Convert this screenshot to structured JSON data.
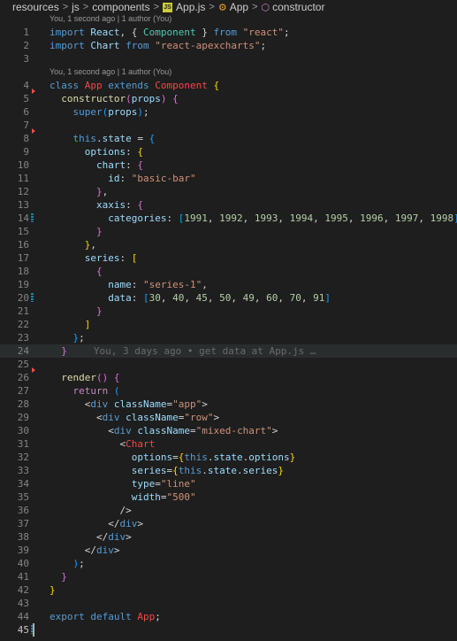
{
  "breadcrumb": {
    "items": [
      "resources",
      "js",
      "components",
      "App.js",
      "App",
      "constructor"
    ],
    "js_badge": "JS"
  },
  "lens": {
    "top": "You, 1 second ago | 1 author (You)",
    "class": "You, 1 second ago | 1 author (You)"
  },
  "blame_line24": "You, 3 days ago • get data at App.js …",
  "lines": [
    {
      "n": "1",
      "tokens": [
        [
          "k",
          "import "
        ],
        [
          "v",
          "React"
        ],
        [
          "p",
          ", { "
        ],
        [
          "c",
          "Component"
        ],
        [
          "p",
          " } "
        ],
        [
          "k",
          "from "
        ],
        [
          "s",
          "\"react\""
        ],
        [
          "p",
          ";"
        ]
      ]
    },
    {
      "n": "2",
      "tokens": [
        [
          "k",
          "import "
        ],
        [
          "v",
          "Chart "
        ],
        [
          "k",
          "from "
        ],
        [
          "s",
          "\"react-apexcharts\""
        ],
        [
          "p",
          ";"
        ]
      ]
    },
    {
      "n": "3",
      "tokens": []
    },
    {
      "n": "4",
      "tokens": [
        [
          "k",
          "class "
        ],
        [
          "err",
          "App"
        ],
        [
          "k",
          " extends "
        ],
        [
          "err",
          "Component"
        ],
        [
          "b1",
          " {"
        ]
      ]
    },
    {
      "n": "5",
      "tokens": [
        [
          "p",
          "  "
        ],
        [
          "f",
          "constructor"
        ],
        [
          "b2",
          "("
        ],
        [
          "v",
          "props"
        ],
        [
          "b2",
          ")"
        ],
        [
          "p",
          " "
        ],
        [
          "b2",
          "{"
        ]
      ]
    },
    {
      "n": "6",
      "tokens": [
        [
          "p",
          "    "
        ],
        [
          "k",
          "super"
        ],
        [
          "b3",
          "("
        ],
        [
          "v",
          "props"
        ],
        [
          "b3",
          ")"
        ],
        [
          "p",
          ";"
        ]
      ]
    },
    {
      "n": "7",
      "tokens": []
    },
    {
      "n": "8",
      "tokens": [
        [
          "p",
          "    "
        ],
        [
          "k",
          "this"
        ],
        [
          "p",
          "."
        ],
        [
          "v",
          "state"
        ],
        [
          "p",
          " = "
        ],
        [
          "b3",
          "{"
        ]
      ]
    },
    {
      "n": "9",
      "tokens": [
        [
          "p",
          "      "
        ],
        [
          "v",
          "options"
        ],
        [
          "p",
          ": "
        ],
        [
          "b1",
          "{"
        ]
      ]
    },
    {
      "n": "10",
      "tokens": [
        [
          "p",
          "        "
        ],
        [
          "v",
          "chart"
        ],
        [
          "p",
          ": "
        ],
        [
          "b2",
          "{"
        ]
      ]
    },
    {
      "n": "11",
      "tokens": [
        [
          "p",
          "          "
        ],
        [
          "v",
          "id"
        ],
        [
          "p",
          ": "
        ],
        [
          "s",
          "\"basic-bar\""
        ]
      ]
    },
    {
      "n": "12",
      "tokens": [
        [
          "p",
          "        "
        ],
        [
          "b2",
          "}"
        ],
        [
          "p",
          ","
        ]
      ]
    },
    {
      "n": "13",
      "tokens": [
        [
          "p",
          "        "
        ],
        [
          "v",
          "xaxis"
        ],
        [
          "p",
          ": "
        ],
        [
          "b2",
          "{"
        ]
      ]
    },
    {
      "n": "14",
      "tokens": [
        [
          "p",
          "          "
        ],
        [
          "v",
          "categories"
        ],
        [
          "p",
          ": "
        ],
        [
          "b3",
          "["
        ],
        [
          "n",
          "1991"
        ],
        [
          "p",
          ", "
        ],
        [
          "n",
          "1992"
        ],
        [
          "p",
          ", "
        ],
        [
          "n",
          "1993"
        ],
        [
          "p",
          ", "
        ],
        [
          "n",
          "1994"
        ],
        [
          "p",
          ", "
        ],
        [
          "n",
          "1995"
        ],
        [
          "p",
          ", "
        ],
        [
          "n",
          "1996"
        ],
        [
          "p",
          ", "
        ],
        [
          "n",
          "1997"
        ],
        [
          "p",
          ", "
        ],
        [
          "n",
          "1998"
        ],
        [
          "b3",
          "]"
        ]
      ]
    },
    {
      "n": "15",
      "tokens": [
        [
          "p",
          "        "
        ],
        [
          "b2",
          "}"
        ]
      ]
    },
    {
      "n": "16",
      "tokens": [
        [
          "p",
          "      "
        ],
        [
          "b1",
          "}"
        ],
        [
          "p",
          ","
        ]
      ]
    },
    {
      "n": "17",
      "tokens": [
        [
          "p",
          "      "
        ],
        [
          "v",
          "series"
        ],
        [
          "p",
          ": "
        ],
        [
          "b1",
          "["
        ]
      ]
    },
    {
      "n": "18",
      "tokens": [
        [
          "p",
          "        "
        ],
        [
          "b2",
          "{"
        ]
      ]
    },
    {
      "n": "19",
      "tokens": [
        [
          "p",
          "          "
        ],
        [
          "v",
          "name"
        ],
        [
          "p",
          ": "
        ],
        [
          "s",
          "\"series-1\""
        ],
        [
          "p",
          ","
        ]
      ]
    },
    {
      "n": "20",
      "tokens": [
        [
          "p",
          "          "
        ],
        [
          "v",
          "data"
        ],
        [
          "p",
          ": "
        ],
        [
          "b3",
          "["
        ],
        [
          "n",
          "30"
        ],
        [
          "p",
          ", "
        ],
        [
          "n",
          "40"
        ],
        [
          "p",
          ", "
        ],
        [
          "n",
          "45"
        ],
        [
          "p",
          ", "
        ],
        [
          "n",
          "50"
        ],
        [
          "p",
          ", "
        ],
        [
          "n",
          "49"
        ],
        [
          "p",
          ", "
        ],
        [
          "n",
          "60"
        ],
        [
          "p",
          ", "
        ],
        [
          "n",
          "70"
        ],
        [
          "p",
          ", "
        ],
        [
          "n",
          "91"
        ],
        [
          "b3",
          "]"
        ]
      ]
    },
    {
      "n": "21",
      "tokens": [
        [
          "p",
          "        "
        ],
        [
          "b2",
          "}"
        ]
      ]
    },
    {
      "n": "22",
      "tokens": [
        [
          "p",
          "      "
        ],
        [
          "b1",
          "]"
        ]
      ]
    },
    {
      "n": "23",
      "tokens": [
        [
          "p",
          "    "
        ],
        [
          "b3",
          "}"
        ],
        [
          "p",
          ";"
        ]
      ]
    },
    {
      "n": "24",
      "tokens": [
        [
          "p",
          "  "
        ],
        [
          "b2",
          "}"
        ]
      ],
      "blame": true
    },
    {
      "n": "25",
      "tokens": []
    },
    {
      "n": "26",
      "tokens": [
        [
          "p",
          "  "
        ],
        [
          "f",
          "render"
        ],
        [
          "b2",
          "()"
        ],
        [
          "p",
          " "
        ],
        [
          "b2",
          "{"
        ]
      ]
    },
    {
      "n": "27",
      "tokens": [
        [
          "p",
          "    "
        ],
        [
          "kp",
          "return "
        ],
        [
          "b3",
          "("
        ]
      ]
    },
    {
      "n": "28",
      "tokens": [
        [
          "p",
          "      "
        ],
        [
          "p",
          "<"
        ],
        [
          "t",
          "div "
        ],
        [
          "a",
          "className"
        ],
        [
          "p",
          "="
        ],
        [
          "s",
          "\"app\""
        ],
        [
          "p",
          ">"
        ]
      ]
    },
    {
      "n": "29",
      "tokens": [
        [
          "p",
          "        "
        ],
        [
          "p",
          "<"
        ],
        [
          "t",
          "div "
        ],
        [
          "a",
          "className"
        ],
        [
          "p",
          "="
        ],
        [
          "s",
          "\"row\""
        ],
        [
          "p",
          ">"
        ]
      ]
    },
    {
      "n": "30",
      "tokens": [
        [
          "p",
          "          "
        ],
        [
          "p",
          "<"
        ],
        [
          "t",
          "div "
        ],
        [
          "a",
          "className"
        ],
        [
          "p",
          "="
        ],
        [
          "s",
          "\"mixed-chart\""
        ],
        [
          "p",
          ">"
        ]
      ]
    },
    {
      "n": "31",
      "tokens": [
        [
          "p",
          "            "
        ],
        [
          "p",
          "<"
        ],
        [
          "err",
          "Chart"
        ]
      ]
    },
    {
      "n": "32",
      "tokens": [
        [
          "p",
          "              "
        ],
        [
          "a",
          "options"
        ],
        [
          "p",
          "="
        ],
        [
          "b1",
          "{"
        ],
        [
          "k",
          "this"
        ],
        [
          "p",
          "."
        ],
        [
          "v",
          "state"
        ],
        [
          "p",
          "."
        ],
        [
          "v",
          "options"
        ],
        [
          "b1",
          "}"
        ]
      ]
    },
    {
      "n": "33",
      "tokens": [
        [
          "p",
          "              "
        ],
        [
          "a",
          "series"
        ],
        [
          "p",
          "="
        ],
        [
          "b1",
          "{"
        ],
        [
          "k",
          "this"
        ],
        [
          "p",
          "."
        ],
        [
          "v",
          "state"
        ],
        [
          "p",
          "."
        ],
        [
          "v",
          "series"
        ],
        [
          "b1",
          "}"
        ]
      ]
    },
    {
      "n": "34",
      "tokens": [
        [
          "p",
          "              "
        ],
        [
          "a",
          "type"
        ],
        [
          "p",
          "="
        ],
        [
          "s",
          "\"line\""
        ]
      ]
    },
    {
      "n": "35",
      "tokens": [
        [
          "p",
          "              "
        ],
        [
          "a",
          "width"
        ],
        [
          "p",
          "="
        ],
        [
          "s",
          "\"500\""
        ]
      ]
    },
    {
      "n": "36",
      "tokens": [
        [
          "p",
          "            "
        ],
        [
          "p",
          "/>"
        ]
      ]
    },
    {
      "n": "37",
      "tokens": [
        [
          "p",
          "          "
        ],
        [
          "p",
          "</"
        ],
        [
          "t",
          "div"
        ],
        [
          "p",
          ">"
        ]
      ]
    },
    {
      "n": "38",
      "tokens": [
        [
          "p",
          "        "
        ],
        [
          "p",
          "</"
        ],
        [
          "t",
          "div"
        ],
        [
          "p",
          ">"
        ]
      ]
    },
    {
      "n": "39",
      "tokens": [
        [
          "p",
          "      "
        ],
        [
          "p",
          "</"
        ],
        [
          "t",
          "div"
        ],
        [
          "p",
          ">"
        ]
      ]
    },
    {
      "n": "40",
      "tokens": [
        [
          "p",
          "    "
        ],
        [
          "b3",
          ")"
        ],
        [
          "p",
          ";"
        ]
      ]
    },
    {
      "n": "41",
      "tokens": [
        [
          "p",
          "  "
        ],
        [
          "b2",
          "}"
        ]
      ]
    },
    {
      "n": "42",
      "tokens": [
        [
          "b1",
          "}"
        ]
      ]
    },
    {
      "n": "43",
      "tokens": []
    },
    {
      "n": "44",
      "tokens": [
        [
          "k",
          "export default "
        ],
        [
          "err",
          "App"
        ],
        [
          "p",
          ";"
        ]
      ]
    },
    {
      "n": "45",
      "tokens": []
    }
  ]
}
